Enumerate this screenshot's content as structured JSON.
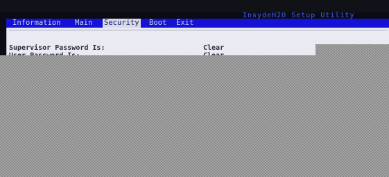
{
  "window": {
    "title": "InsydeH2O Setup Utility"
  },
  "menu": {
    "tabs": [
      {
        "label": "Information",
        "active": false
      },
      {
        "label": "Main",
        "active": false
      },
      {
        "label": "Security",
        "active": true
      },
      {
        "label": "Boot",
        "active": false
      },
      {
        "label": "Exit",
        "active": false
      }
    ]
  },
  "security": {
    "settings": [
      {
        "label": "Supervisor Password Is:",
        "value": "Clear"
      },
      {
        "label": "User Password Is:",
        "value": "Clear"
      }
    ]
  },
  "colors": {
    "menu_bar": "#1512d6",
    "active_tab": "#d8dae6",
    "panel": "#e9eaf2",
    "title_text": "#3f5fff"
  }
}
